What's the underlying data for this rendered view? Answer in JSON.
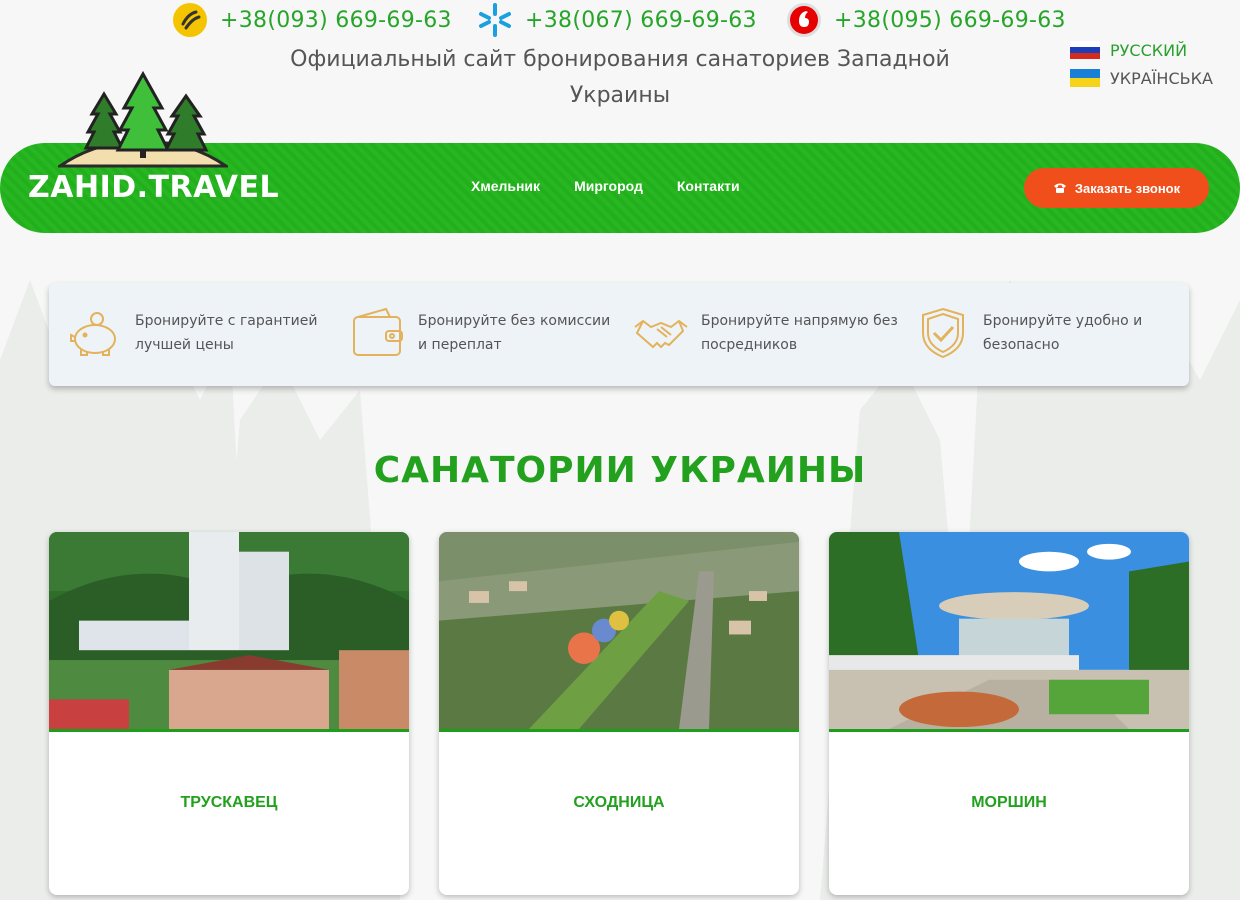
{
  "phones": [
    {
      "number": "+38(093) 669-69-63",
      "operator_icon": "lifecell-icon",
      "color": "#f5c400"
    },
    {
      "number": "+38(067) 669-69-63",
      "operator_icon": "kyivstar-icon",
      "color": "#1a9fe0"
    },
    {
      "number": "+38(095) 669-69-63",
      "operator_icon": "vodafone-icon",
      "color": "#e60000"
    }
  ],
  "tagline": "Официальный сайт бронирования санаториев Западной Украины",
  "languages": [
    {
      "label": "РУССКИЙ",
      "flag": "russia-flag-icon",
      "active": true
    },
    {
      "label": "УКРАЇНСЬКА",
      "flag": "ukraine-flag-icon",
      "active": false
    }
  ],
  "logo": {
    "text": "ZAHID.TRAVEL"
  },
  "nav": {
    "links": [
      "Хмельник",
      "Миргород",
      "Контакти"
    ],
    "call_button": {
      "icon": "phone-icon",
      "label": "Заказать звонок"
    }
  },
  "features": [
    {
      "icon": "piggy-bank-icon",
      "text": "Бронируйте с гарантией лучшей цены"
    },
    {
      "icon": "wallet-icon",
      "text": "Бронируйте без комиссии и переплат"
    },
    {
      "icon": "handshake-icon",
      "text": "Бронируйте напрямую без посредников"
    },
    {
      "icon": "shield-check-icon",
      "text": "Бронируйте удобно и безопасно"
    }
  ],
  "section_title": "САНАТОРИИ УКРАИНЫ",
  "cards": [
    {
      "name": "ТРУСКАВЕЦ"
    },
    {
      "name": "СХОДНИЦА"
    },
    {
      "name": "МОРШИН"
    }
  ],
  "colors": {
    "brand_green": "#22b41c",
    "title_green": "#23a11e",
    "accent_orange": "#f04e1b",
    "icon_gold": "#e3b25a"
  }
}
